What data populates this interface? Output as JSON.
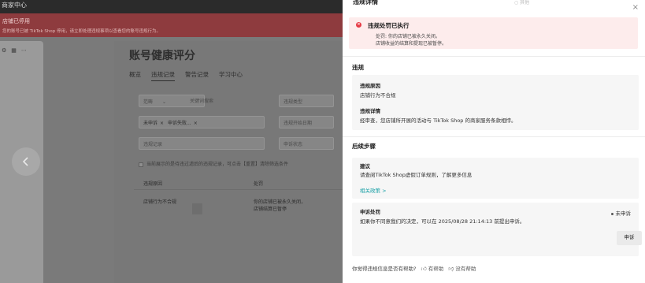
{
  "background": {
    "topbar_title": "商家中心",
    "banner": {
      "title": "店铺已停用",
      "desc": "您的账号已被 TikTok Shop 停用，请立即处理违规事项以查看您的账号违规行为。"
    },
    "page_title": "账号健康评分",
    "tabs": [
      "概览",
      "违规记录",
      "警告记录",
      "学习中心"
    ],
    "filters": {
      "scope_label": "范畴",
      "keyword_placeholder": "关键词搜索",
      "type_placeholder": "违规类型",
      "chip_1": "未申诉",
      "chip_2": "申诉失败...",
      "date_placeholder": "违规开始日期",
      "record_placeholder": "违规记录",
      "appeal_placeholder": "申诉状态"
    },
    "notice": "当前展示的是待违过滤后的违规记录，可点击【重置】清除筛选条件",
    "table": {
      "col_1": "违规原因",
      "col_2": "处罚",
      "row_1_reason": "店铺行为不合规",
      "row_1_penalty_1": "你的店铺已被永久关闭，",
      "row_1_penalty_2": "店铺结算已暂停"
    },
    "top_right_label": "其他"
  },
  "drawer": {
    "title": "违规详情",
    "close_icon": "close-icon",
    "alert": {
      "title": "违规处罚已执行",
      "line_1": "处罚: 你的店铺已被永久关闭。",
      "line_2": "店铺收益的结算和提现已被暂停。"
    },
    "violation_section": {
      "heading": "违规",
      "reason_label": "违规原因",
      "reason_value": "店铺行为不合规",
      "detail_label": "违规详情",
      "detail_value": "经审查，您店铺所开展的活动与 TikTok Shop 的商家服务条款相悖。"
    },
    "next_steps": {
      "heading": "后续步骤",
      "suggestion_label": "建议",
      "suggestion_value": "请查阅TikTok Shop虚假订单规则，了解更多信息",
      "policy_link": "相关政策 >",
      "appeal_label": "申诉处罚",
      "appeal_value": "如果你不同意我们的决定，可以在 2025/08/28 21:14:13 前提出申诉。",
      "status": "未申诉",
      "appeal_button": "申诉"
    },
    "feedback": {
      "question": "你觉得违规信息是否有帮助?",
      "helpful": "有帮助",
      "not_helpful": "没有帮助"
    }
  },
  "colors": {
    "alert_bg": "#fdecec",
    "alert_icon": "#e63b46",
    "link": "#1aa0a6",
    "overlay": "#7a7a7a"
  }
}
